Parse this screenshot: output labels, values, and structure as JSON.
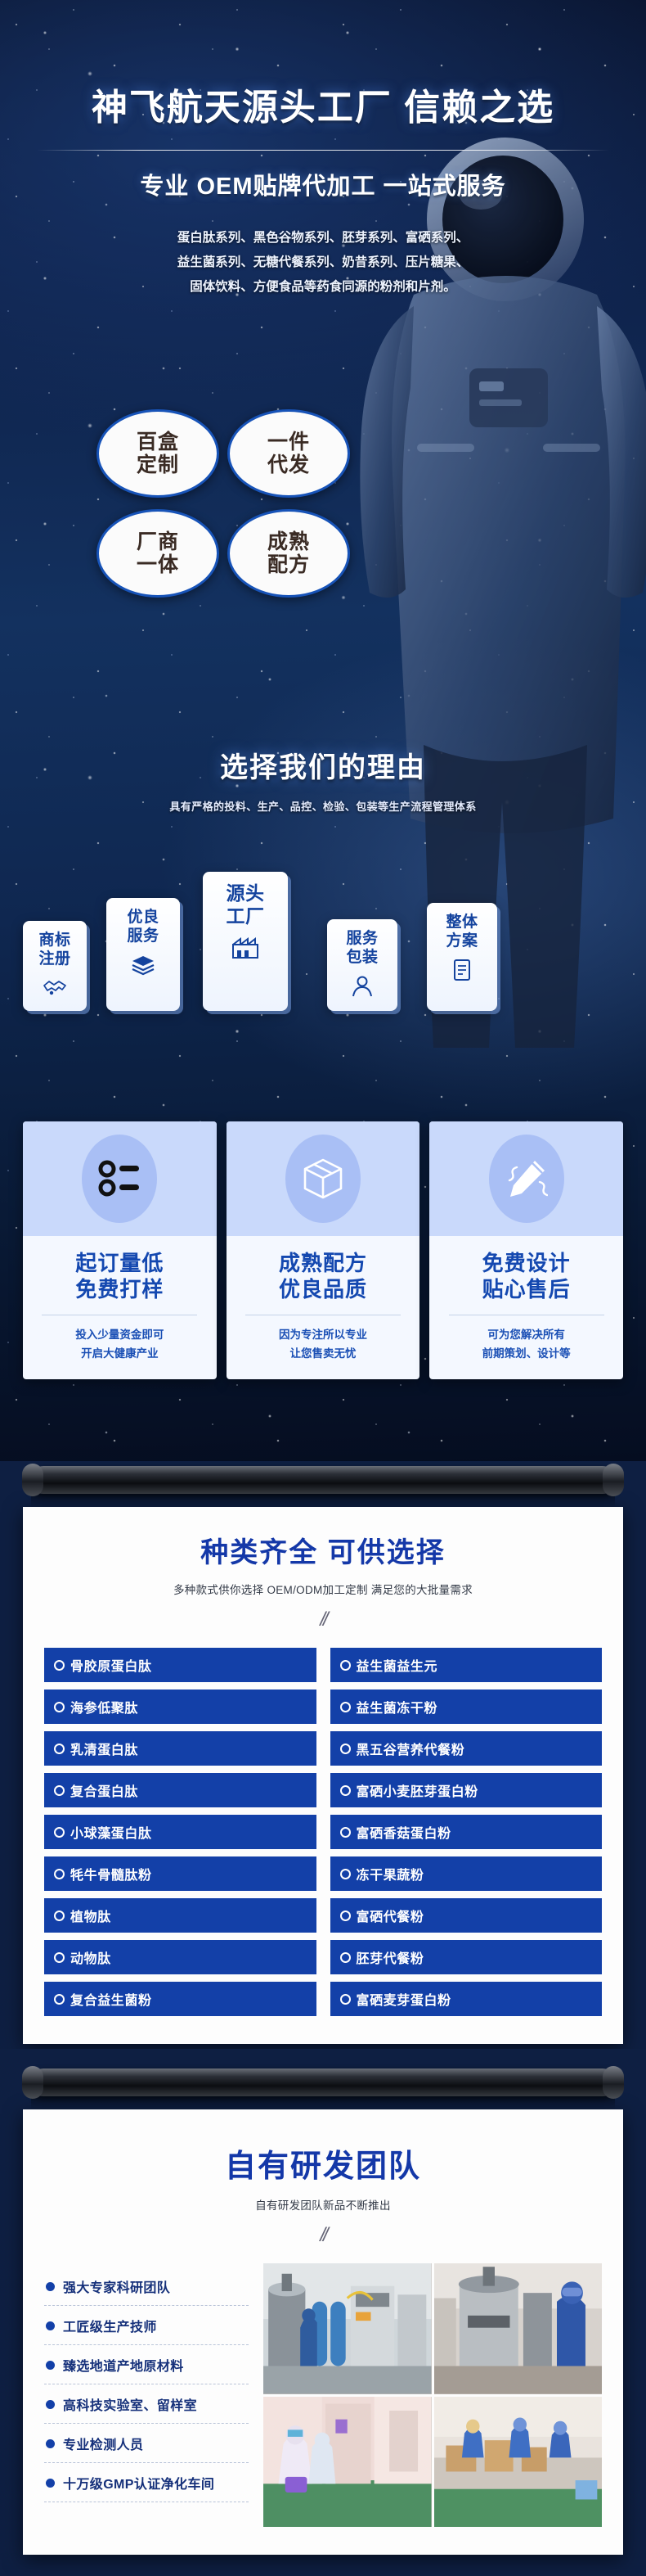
{
  "hero": {
    "headline": "神飞航天源头工厂 信赖之选",
    "subhead": "专业 OEM贴牌代加工 一站式服务",
    "desc_lines": [
      "蛋白肽系列、黑色谷物系列、胚芽系列、富硒系列、",
      "益生菌系列、无糖代餐系列、奶昔系列、压片糖果、",
      "固体饮料、方便食品等药食同源的粉剂和片剂。"
    ],
    "badges": [
      {
        "line1": "百盒",
        "line2": "定制"
      },
      {
        "line1": "一件",
        "line2": "代发"
      },
      {
        "line1": "厂商",
        "line2": "一体"
      },
      {
        "line1": "成熟",
        "line2": "配方"
      }
    ],
    "reasons_title": "选择我们的理由",
    "reasons_sub": "具有严格的投料、生产、品控、检验、包装等生产流程管理体系",
    "stair_cards": [
      {
        "line1": "商标",
        "line2": "注册",
        "icon": "handshake-icon"
      },
      {
        "line1": "优良",
        "line2": "服务",
        "icon": "layers-icon"
      },
      {
        "line1": "源头",
        "line2": "工厂",
        "icon": "factory-icon"
      },
      {
        "line1": "服务",
        "line2": "包装",
        "icon": "person-icon"
      },
      {
        "line1": "整体",
        "line2": "方案",
        "icon": "document-icon"
      }
    ],
    "features": [
      {
        "icon": "list-icon",
        "title_line1": "起订量低",
        "title_line2": "免费打样",
        "note_line1": "投入少量资金即可",
        "note_line2": "开启大健康产业"
      },
      {
        "icon": "box-icon",
        "title_line1": "成熟配方",
        "title_line2": "优良品质",
        "note_line1": "因为专注所以专业",
        "note_line2": "让您售卖无忧"
      },
      {
        "icon": "pencil-icon",
        "title_line1": "免费设计",
        "title_line2": "贴心售后",
        "note_line1": "可为您解决所有",
        "note_line2": "前期策划、设计等"
      }
    ]
  },
  "products_section": {
    "title": "种类齐全 可供选择",
    "subtitle": "多种款式供你选择 OEM/ODM加工定制 满足您的大批量需求",
    "divider": "//",
    "left_column": [
      "骨胶原蛋白肽",
      "海参低聚肽",
      "乳清蛋白肽",
      "复合蛋白肽",
      "小球藻蛋白肽",
      "牦牛骨髓肽粉",
      "植物肽",
      "动物肽",
      "复合益生菌粉"
    ],
    "right_column": [
      "益生菌益生元",
      "益生菌冻干粉",
      "黑五谷营养代餐粉",
      "富硒小麦胚芽蛋白粉",
      "富硒香菇蛋白粉",
      "冻干果蔬粉",
      "富硒代餐粉",
      "胚芽代餐粉",
      "富硒麦芽蛋白粉"
    ]
  },
  "rd_section": {
    "title": "自有研发团队",
    "subtitle": "自有研发团队新品不断推出",
    "divider": "//",
    "items": [
      "强大专家科研团队",
      "工匠级生产技师",
      "臻选地道产地原材料",
      "高科技实验室、留样室",
      "专业检测人员",
      "十万级GMP认证净化车间"
    ],
    "photos": [
      "factory-equipment-photo",
      "worker-mixer-photo",
      "cleanroom-corridor-photo",
      "packaging-line-photo"
    ]
  },
  "colors": {
    "brand_blue": "#1340a8",
    "deep_navy": "#0b1a3d",
    "title_blue": "#1438a8",
    "card_blue": "#14439e",
    "icon_fill": "#a9bff5"
  }
}
